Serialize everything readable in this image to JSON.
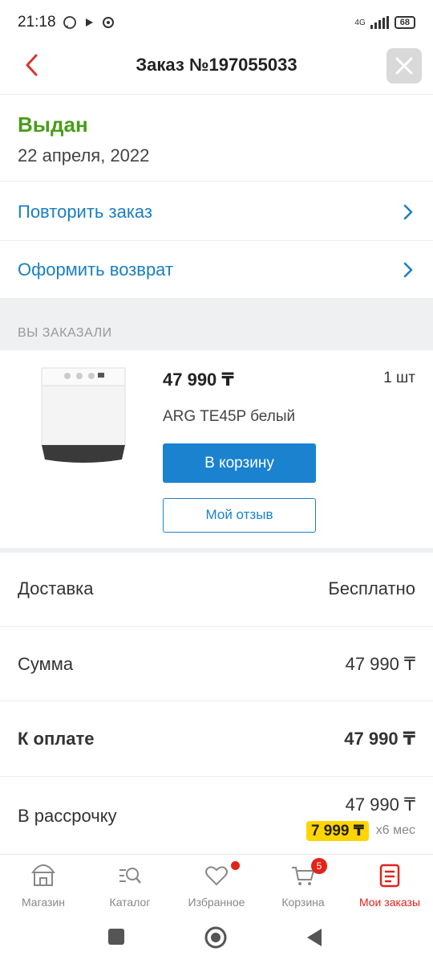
{
  "status_bar": {
    "time": "21:18",
    "network": "4G",
    "battery": "68"
  },
  "header": {
    "title": "Заказ №197055033"
  },
  "order_status": {
    "status": "Выдан",
    "date": "22 апреля, 2022"
  },
  "actions": [
    {
      "label": "Повторить заказ"
    },
    {
      "label": "Оформить возврат"
    }
  ],
  "section_title": "ВЫ ЗАКАЗАЛИ",
  "product": {
    "price": "47 990 ₸",
    "quantity": "1 шт",
    "name": "ARG TE45P белый",
    "cart_button": "В корзину",
    "review_button": "Мой отзыв"
  },
  "summary": {
    "delivery_label": "Доставка",
    "delivery_value": "Бесплатно",
    "sum_label": "Сумма",
    "sum_value": "47 990 ₸",
    "to_pay_label": "К оплате",
    "to_pay_value": "47 990 ₸",
    "installment_label": "В рассрочку",
    "installment_total": "47 990 ₸",
    "installment_monthly": "7 999 ₸",
    "installment_term": "х6 мес"
  },
  "tabs": [
    {
      "label": "Магазин",
      "icon": "shop-icon"
    },
    {
      "label": "Каталог",
      "icon": "catalog-search-icon"
    },
    {
      "label": "Избранное",
      "icon": "heart-icon"
    },
    {
      "label": "Корзина",
      "icon": "cart-icon",
      "badge": "5"
    },
    {
      "label": "Мои заказы",
      "icon": "orders-icon",
      "active": true
    }
  ],
  "colors": {
    "accent_blue": "#1a82cf",
    "status_green": "#4a9c1a",
    "active_red": "#e2231a",
    "installment_yellow": "#ffd500"
  }
}
